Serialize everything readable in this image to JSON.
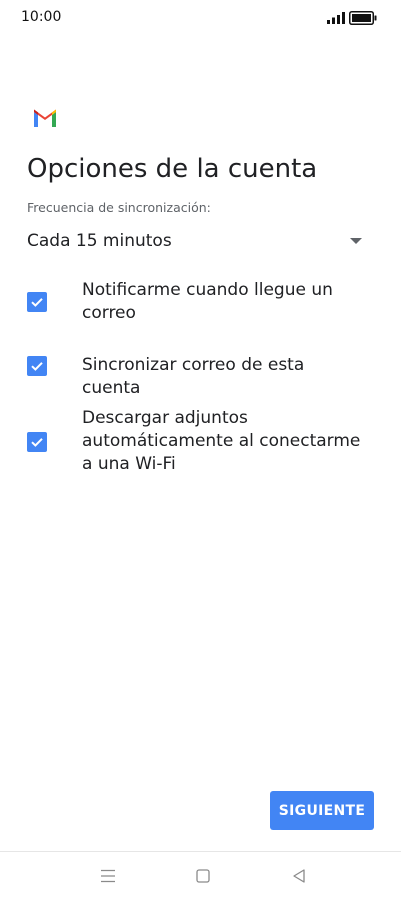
{
  "status_bar": {
    "time": "10:00",
    "icons": [
      "signal-icon",
      "battery-icon"
    ]
  },
  "app": {
    "logo": "gmail-logo",
    "colors": {
      "accent": "#4285f4",
      "gmail_red": "#ea4335",
      "gmail_blue": "#4285f4",
      "gmail_green": "#34a853",
      "gmail_yellow": "#fbbc04"
    }
  },
  "page": {
    "title": "Opciones de la cuenta"
  },
  "sync": {
    "label": "Frecuencia de sincronización:",
    "selected": "Cada 15 minutos"
  },
  "options": [
    {
      "label": "Notificarme cuando llegue un correo",
      "checked": true
    },
    {
      "label": "Sincronizar correo de esta cuenta",
      "checked": true
    },
    {
      "label": "Descargar adjuntos automáticamente al conectarme a una Wi-Fi",
      "checked": true
    }
  ],
  "actions": {
    "next_label": "SIGUIENTE"
  },
  "nav_bar": {
    "buttons": [
      "menu-icon",
      "home-icon",
      "back-icon"
    ]
  }
}
